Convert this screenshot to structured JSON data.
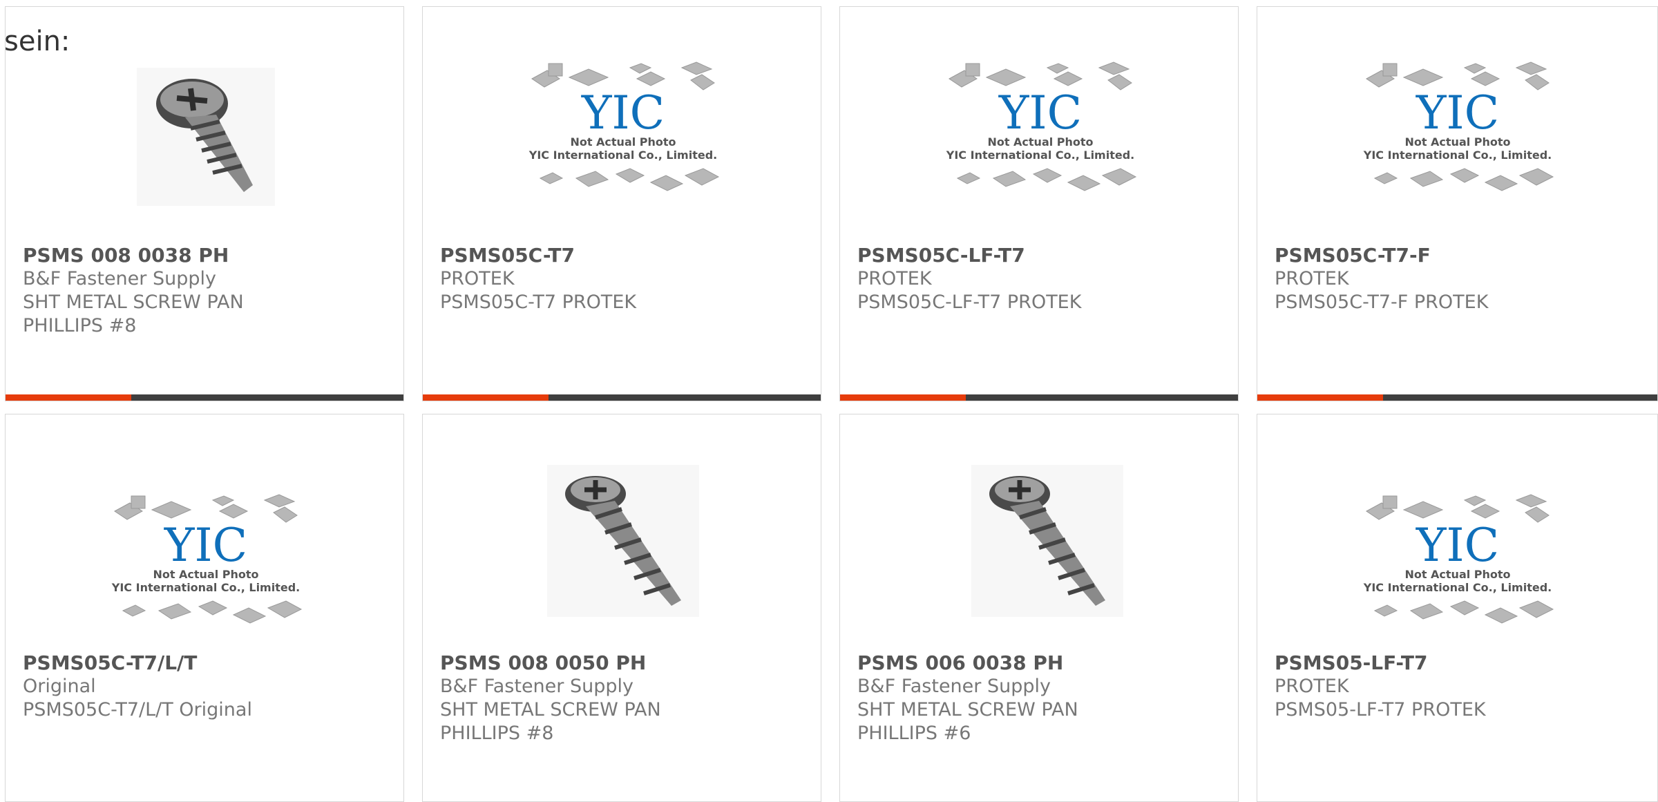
{
  "lead_text": "sein:",
  "colors": {
    "accent": "#e63c0c",
    "bar": "#3f3f3f",
    "border": "#d7d7d7"
  },
  "placeholder": {
    "logo_text": "YIC",
    "caption_1": "Not Actual Photo",
    "caption_2": "YIC International Co., Limited."
  },
  "products": [
    {
      "title": "PSMS 008 0038 PH",
      "lines": [
        "B&F Fastener Supply",
        "SHT METAL SCREW PAN",
        "PHILLIPS #8"
      ],
      "image": "screw-photo-icon"
    },
    {
      "title": "PSMS05C-T7",
      "lines": [
        "PROTEK",
        "PSMS05C-T7 PROTEK",
        ""
      ],
      "image": "not-actual-photo-placeholder"
    },
    {
      "title": "PSMS05C-LF-T7",
      "lines": [
        "PROTEK",
        "PSMS05C-LF-T7 PROTEK",
        ""
      ],
      "image": "not-actual-photo-placeholder"
    },
    {
      "title": "PSMS05C-T7-F",
      "lines": [
        "PROTEK",
        "PSMS05C-T7-F PROTEK",
        ""
      ],
      "image": "not-actual-photo-placeholder"
    },
    {
      "title": "PSMS05C-T7/L/T",
      "lines": [
        "Original",
        "PSMS05C-T7/L/T Original",
        ""
      ],
      "image": "not-actual-photo-placeholder"
    },
    {
      "title": "PSMS 008 0050 PH",
      "lines": [
        "B&F Fastener Supply",
        "SHT METAL SCREW PAN",
        "PHILLIPS #8"
      ],
      "image": "screw-photo-icon"
    },
    {
      "title": "PSMS 006 0038 PH",
      "lines": [
        "B&F Fastener Supply",
        "SHT METAL SCREW PAN",
        "PHILLIPS #6"
      ],
      "image": "screw-photo-icon"
    },
    {
      "title": "PSMS05-LF-T7",
      "lines": [
        "PROTEK",
        "PSMS05-LF-T7 PROTEK",
        ""
      ],
      "image": "not-actual-photo-placeholder"
    }
  ]
}
